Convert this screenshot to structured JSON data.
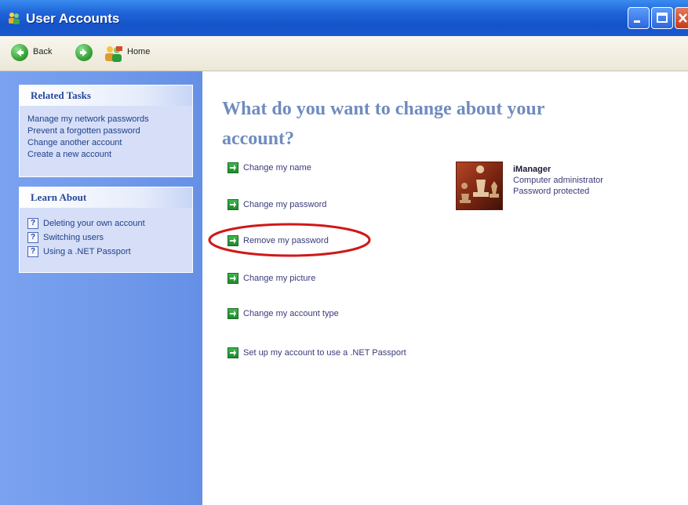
{
  "window": {
    "title": "User Accounts"
  },
  "toolbar": {
    "back_label": "Back",
    "home_label": "Home"
  },
  "related_tasks": {
    "title": "Related Tasks",
    "items": [
      "Manage my network passwords",
      "Prevent a forgotten password",
      "Change another account",
      "Create a new account"
    ]
  },
  "learn_about": {
    "title": "Learn About",
    "items": [
      "Deleting your own account",
      "Switching users",
      "Using a .NET Passport"
    ]
  },
  "main": {
    "heading_line1": "What do you want to change about your",
    "heading_line2": "account?",
    "options": [
      "Change my name",
      "Change my password",
      "Remove my password",
      "Change my picture",
      "Change my account type",
      "Set up my account to use a .NET Passport"
    ]
  },
  "account": {
    "name": "iManager",
    "role": "Computer administrator",
    "status": "Password protected"
  },
  "colors": {
    "titlebar": "#1f64d8",
    "sidebar": "#6f98ea",
    "heading": "#6f8cbe",
    "highlight": "#d01818"
  },
  "icons": {
    "back": "back-arrow-icon",
    "forward": "forward-arrow-icon",
    "home": "users-home-icon",
    "option": "green-arrow-icon",
    "help": "help-icon"
  }
}
